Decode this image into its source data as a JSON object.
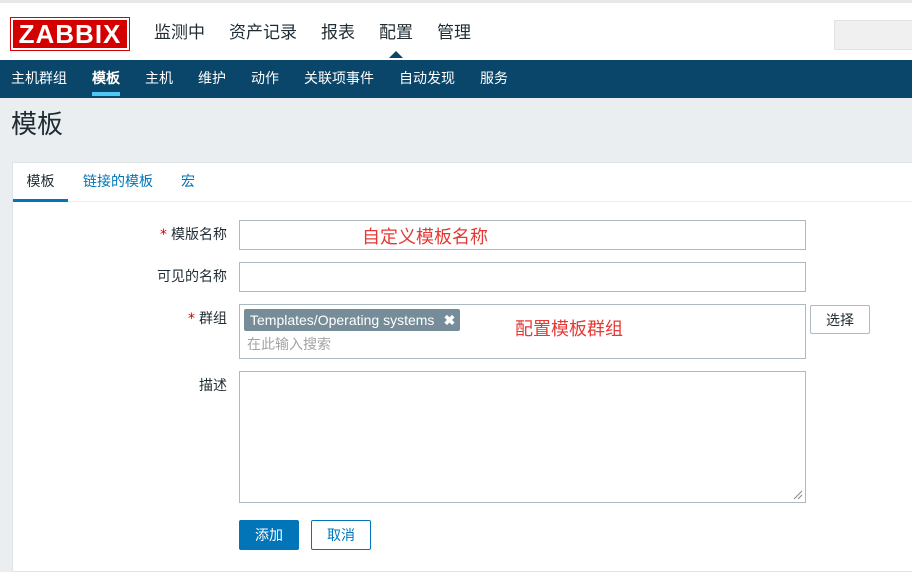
{
  "header": {
    "logo": "ZABBIX",
    "menu": [
      "监测中",
      "资产记录",
      "报表",
      "配置",
      "管理"
    ],
    "active_menu": "配置"
  },
  "subnav": {
    "items": [
      "主机群组",
      "模板",
      "主机",
      "维护",
      "动作",
      "关联项事件",
      "自动发现",
      "服务"
    ],
    "active": "模板"
  },
  "page": {
    "title": "模板"
  },
  "tabs": [
    "模板",
    "链接的模板",
    "宏"
  ],
  "form": {
    "template_name": {
      "label": "模版名称",
      "required": "*",
      "value": ""
    },
    "visible_name": {
      "label": "可见的名称",
      "value": ""
    },
    "groups": {
      "label": "群组",
      "required": "*",
      "selected": [
        "Templates/Operating systems"
      ],
      "remove_glyph": "✖",
      "placeholder": "在此输入搜索",
      "select_button": "选择"
    },
    "description": {
      "label": "描述",
      "value": ""
    }
  },
  "annotations": {
    "name_note": "自定义模板名称",
    "group_note": "配置模板群组"
  },
  "buttons": {
    "add": "添加",
    "cancel": "取消"
  },
  "colors": {
    "brand_red": "#d40000",
    "nav_blue": "#0a466a",
    "accent_blue": "#0275b8",
    "annotation_red": "#e53935",
    "tag_gray": "#768d99"
  }
}
